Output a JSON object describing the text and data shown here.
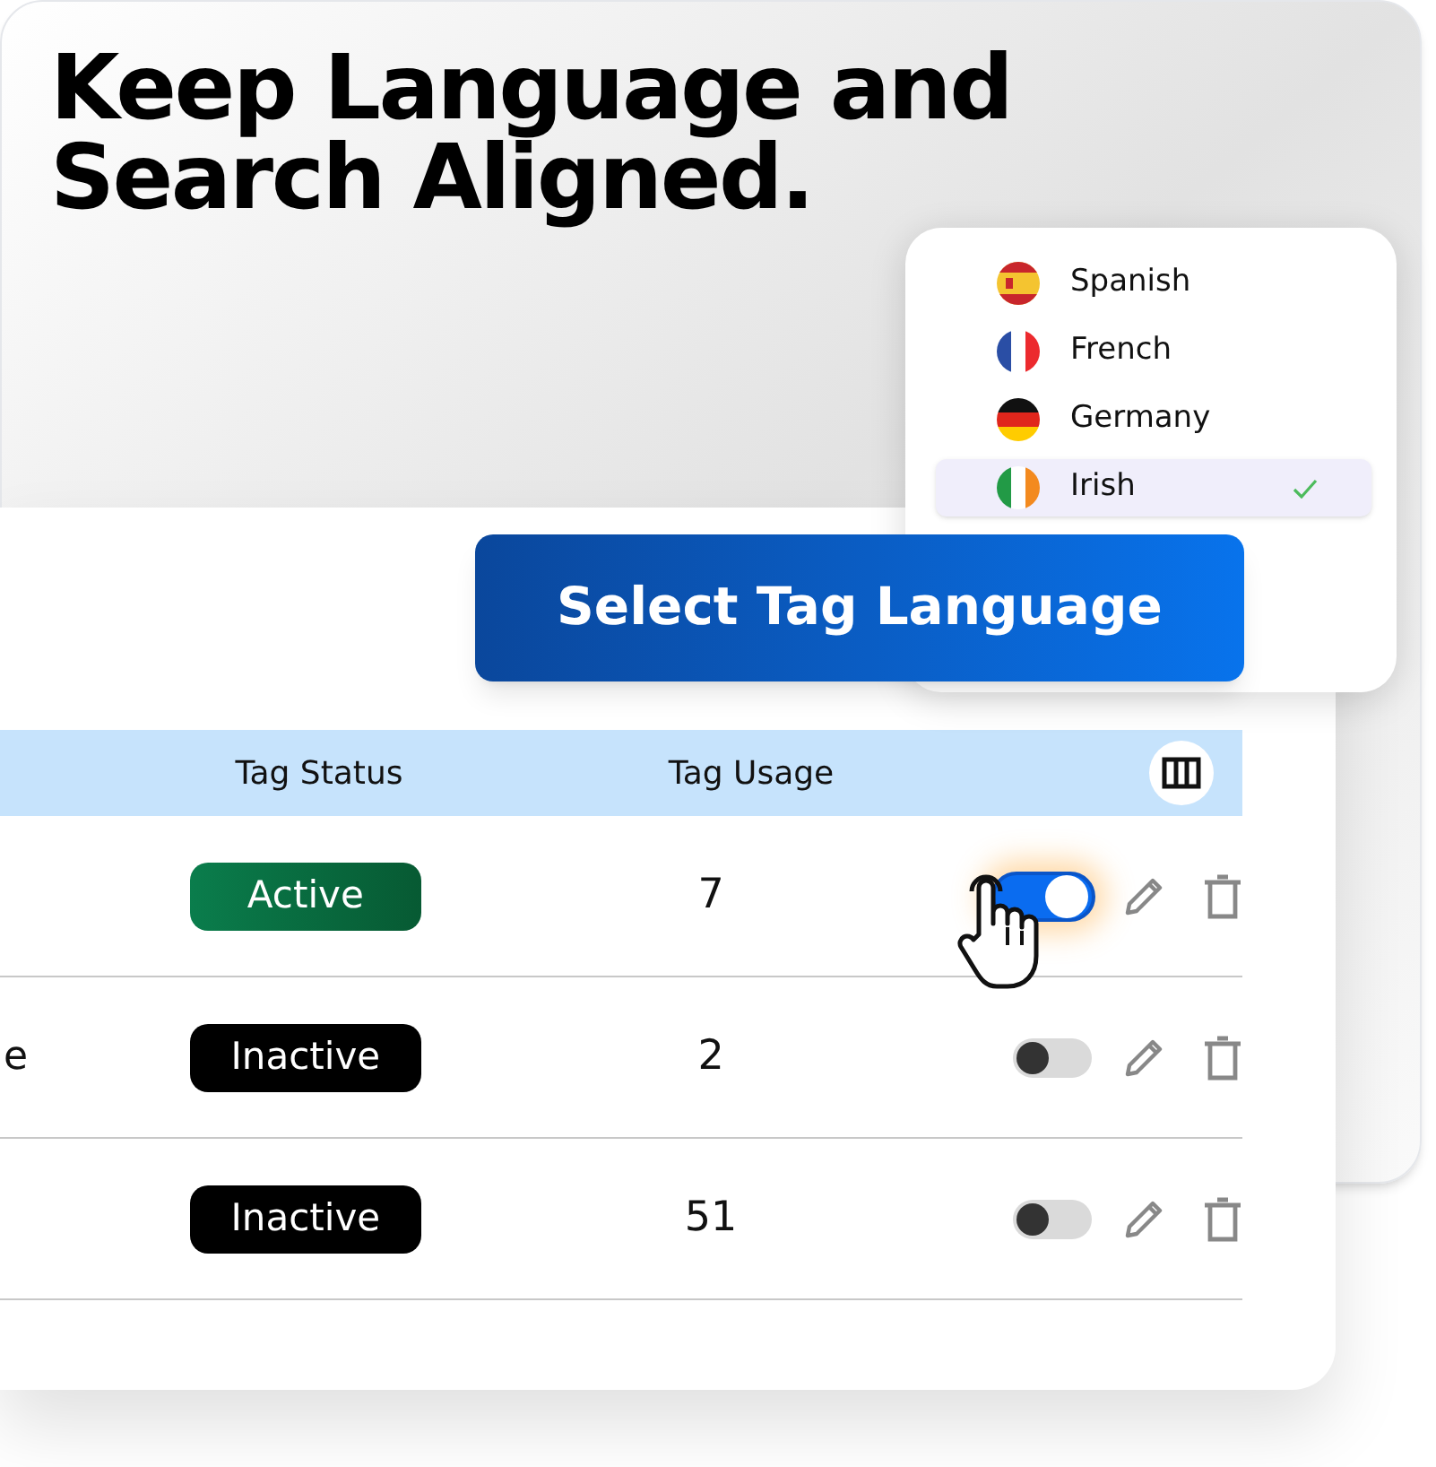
{
  "headline": "Keep Language and Search Aligned.",
  "languages": [
    {
      "label": "Spanish",
      "kind": "es",
      "selected": false
    },
    {
      "label": "French",
      "kind": "fr",
      "selected": false
    },
    {
      "label": "Germany",
      "kind": "de",
      "selected": false
    },
    {
      "label": "Irish",
      "kind": "ie",
      "selected": true
    }
  ],
  "cta_button": "Select Tag Language",
  "table": {
    "columns": [
      "Tag Status",
      "Tag Usage"
    ],
    "rows": [
      {
        "status": "Active",
        "kind": "active",
        "usage": "7",
        "on": true
      },
      {
        "column_1": "e",
        "status": "Inactive",
        "kind": "inactive",
        "usage": "2",
        "on": false
      },
      {
        "status": "Inactive",
        "kind": "inactive",
        "usage": "51",
        "on": false
      }
    ]
  }
}
